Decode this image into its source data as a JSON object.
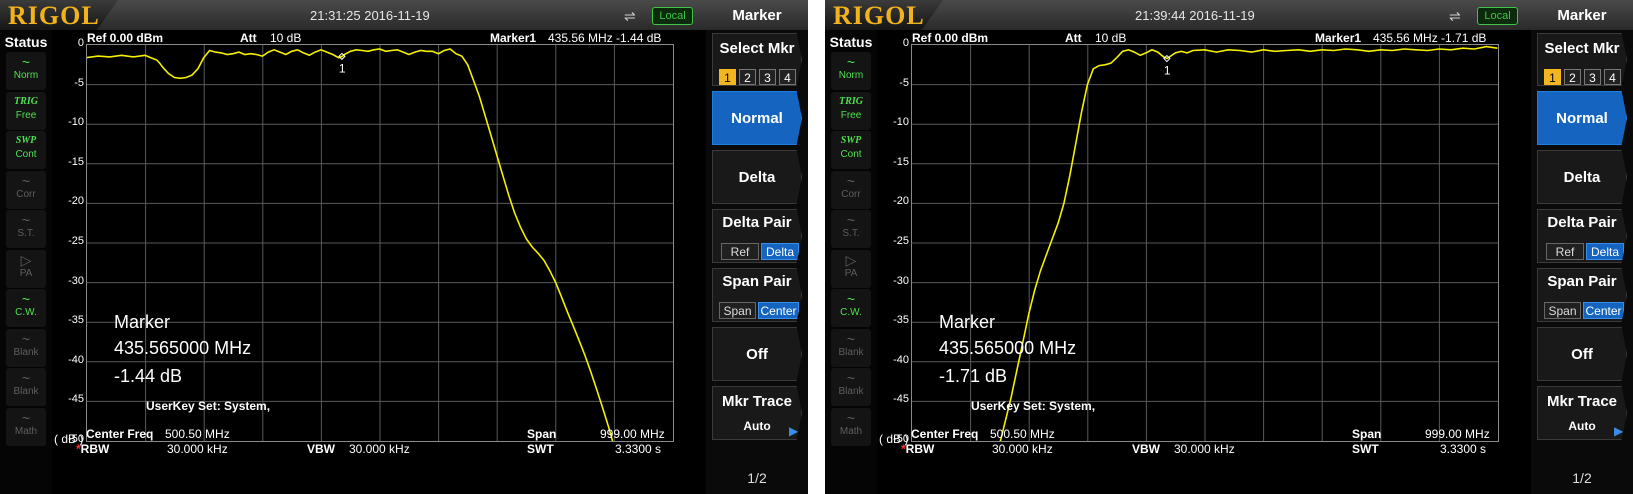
{
  "screens": [
    {
      "logo": "RIGOL",
      "datetime": "21:31:25 2016-11-19",
      "local_label": "Local",
      "status": {
        "title": "Status",
        "items": [
          {
            "icon": "~",
            "label": "Norm",
            "active": true
          },
          {
            "icon": "TRIG",
            "label": "Free",
            "active": true
          },
          {
            "icon": "SWP",
            "label": "Cont",
            "active": true
          },
          {
            "icon": "~",
            "label": "Corr",
            "active": false
          },
          {
            "icon": "~",
            "label": "S.T.",
            "active": false
          },
          {
            "icon": "▷",
            "label": "PA",
            "active": false
          },
          {
            "icon": "~",
            "label": "C.W.",
            "active": true
          },
          {
            "icon": "~",
            "label": "Blank",
            "active": false
          },
          {
            "icon": "~",
            "label": "Blank",
            "active": false
          },
          {
            "icon": "~",
            "label": "Math",
            "active": false
          }
        ]
      },
      "header": {
        "ref": "Ref  0.00 dBm",
        "att_label": "Att",
        "att_value": "10 dB",
        "marker_label": "Marker1",
        "marker_value": "435.56 MHz   -1.44 dB"
      },
      "yticks": [
        "0",
        "-5",
        "-10",
        "-15",
        "-20",
        "-25",
        "-30",
        "-35",
        "-40",
        "-45",
        "-50"
      ],
      "marker_panel": {
        "title": "Marker",
        "freq": "435.565000 MHz",
        "level": "-1.44 dB"
      },
      "marker_flag": "1",
      "userkey": "UserKey Set:   System,",
      "footer": {
        "unit": "( dB )",
        "center_label": "Center Freq",
        "center_value": "500.50 MHz",
        "span_label": "Span",
        "span_value": "999.00 MHz",
        "rbw_star": "*",
        "rbw_label": "RBW",
        "rbw_value": "30.000 kHz",
        "vbw_label": "VBW",
        "vbw_value": "30.000 kHz",
        "swt_label": "SWT",
        "swt_value": "3.3300 s"
      },
      "menu": {
        "title": "Marker",
        "select_mkr": "Select Mkr",
        "mkr_numbers": [
          "1",
          "2",
          "3",
          "4"
        ],
        "normal": "Normal",
        "delta": "Delta",
        "delta_pair": "Delta Pair",
        "delta_pair_ref": "Ref",
        "delta_pair_delta": "Delta",
        "span_pair": "Span Pair",
        "span_pair_span": "Span",
        "span_pair_center": "Center",
        "off": "Off",
        "mkr_trace": "Mkr Trace",
        "mkr_trace_value": "Auto",
        "page": "1/2"
      },
      "chart_data": {
        "type": "line",
        "series": [
          {
            "x": [
              0,
              20,
              40,
              60,
              80,
              100,
              110,
              120,
              125,
              130,
              140,
              150,
              160,
              170,
              180,
              190,
              200,
              210,
              220,
              230,
              240,
              250,
              260,
              270,
              280,
              290,
              300,
              310,
              320,
              330,
              340,
              350,
              360,
              370,
              380,
              390,
              400,
              410,
              420,
              430,
              436,
              440,
              450,
              460,
              470,
              480,
              490,
              500,
              510,
              520,
              530,
              540,
              550,
              560,
              570,
              580,
              590,
              600,
              610,
              620,
              630,
              640,
              650,
              660,
              670,
              680,
              690,
              700,
              710,
              720,
              730,
              740,
              750,
              760,
              770,
              780,
              790,
              800,
              810,
              820,
              830,
              840,
              850,
              860,
              870,
              880,
              890,
              900,
              910,
              920,
              930,
              940,
              950,
              960,
              970,
              980,
              990,
              999
            ],
            "y": [
              -1.6,
              -1.4,
              -1.5,
              -1.3,
              -1.5,
              -1.3,
              -1.6,
              -1.9,
              -2.3,
              -2.8,
              -3.6,
              -4.1,
              -4.2,
              -4.1,
              -3.8,
              -3.0,
              -1.6,
              -0.7,
              -0.9,
              -1.0,
              -1.2,
              -1.1,
              -0.9,
              -1.2,
              -1.1,
              -1.2,
              -1.4,
              -0.9,
              -0.6,
              -0.9,
              -1.2,
              -0.8,
              -0.6,
              -1.0,
              -1.3,
              -0.9,
              -0.6,
              -0.9,
              -1.2,
              -1.6,
              -1.44,
              -1.2,
              -0.8,
              -0.6,
              -0.7,
              -0.8,
              -0.6,
              -0.5,
              -0.8,
              -0.7,
              -0.6,
              -0.9,
              -1.2,
              -0.9,
              -0.7,
              -0.8,
              -0.8,
              -1.1,
              -0.7,
              -0.5,
              -1.1,
              -1.4,
              -2.5,
              -4.5,
              -6.5,
              -9,
              -11.5,
              -14,
              -16.5,
              -19,
              -21.2,
              -23,
              -24.5,
              -25.5,
              -26.3,
              -27.2,
              -28.5,
              -30,
              -31.8,
              -33.7,
              -35.5,
              -37.3,
              -39.2,
              -41.3,
              -43.5,
              -45.8,
              -48.2,
              -50.8
            ],
            "x_real": [
              0,
              20,
              40,
              60,
              80,
              100,
              110,
              120,
              125,
              130,
              140,
              150,
              160,
              170,
              180,
              190,
              200,
              210,
              220,
              230,
              240,
              250,
              260,
              270,
              280,
              290,
              300,
              310,
              320,
              330,
              340,
              350,
              360,
              370,
              380,
              390,
              400,
              410,
              420,
              430,
              436,
              440,
              450,
              460,
              470,
              480,
              490,
              500,
              510,
              520,
              530,
              540,
              550,
              560,
              570,
              580,
              590,
              600,
              610,
              620,
              630,
              640,
              650,
              660,
              670,
              680,
              690,
              700,
              710,
              720,
              730,
              740,
              750,
              760,
              770,
              780,
              790,
              800,
              810,
              820,
              830,
              840,
              850,
              860,
              870,
              880,
              890,
              900
            ]
          }
        ],
        "xlim": [
          1,
          1000
        ],
        "ylim": [
          -50,
          0
        ],
        "ylabel": "( dB )",
        "grid": true,
        "marker": {
          "x": 435.565,
          "y": -1.44
        }
      }
    },
    {
      "logo": "RIGOL",
      "datetime": "21:39:44 2016-11-19",
      "local_label": "Local",
      "status": {
        "title": "Status",
        "items": [
          {
            "icon": "~",
            "label": "Norm",
            "active": true
          },
          {
            "icon": "TRIG",
            "label": "Free",
            "active": true
          },
          {
            "icon": "SWP",
            "label": "Cont",
            "active": true
          },
          {
            "icon": "~",
            "label": "Corr",
            "active": false
          },
          {
            "icon": "~",
            "label": "S.T.",
            "active": false
          },
          {
            "icon": "▷",
            "label": "PA",
            "active": false
          },
          {
            "icon": "~",
            "label": "C.W.",
            "active": true
          },
          {
            "icon": "~",
            "label": "Blank",
            "active": false
          },
          {
            "icon": "~",
            "label": "Blank",
            "active": false
          },
          {
            "icon": "~",
            "label": "Math",
            "active": false
          }
        ]
      },
      "header": {
        "ref": "Ref  0.00 dBm",
        "att_label": "Att",
        "att_value": "10 dB",
        "marker_label": "Marker1",
        "marker_value": "435.56 MHz   -1.71 dB"
      },
      "yticks": [
        "0",
        "-5",
        "-10",
        "-15",
        "-20",
        "-25",
        "-30",
        "-35",
        "-40",
        "-45",
        "-50"
      ],
      "marker_panel": {
        "title": "Marker",
        "freq": "435.565000 MHz",
        "level": "-1.71 dB"
      },
      "marker_flag": "1",
      "userkey": "UserKey Set:   System,",
      "footer": {
        "unit": "( dB )",
        "center_label": "Center Freq",
        "center_value": "500.50 MHz",
        "span_label": "Span",
        "span_value": "999.00 MHz",
        "rbw_star": "*",
        "rbw_label": "RBW",
        "rbw_value": "30.000 kHz",
        "vbw_label": "VBW",
        "vbw_value": "30.000 kHz",
        "swt_label": "SWT",
        "swt_value": "3.3300 s"
      },
      "menu": {
        "title": "Marker",
        "select_mkr": "Select Mkr",
        "mkr_numbers": [
          "1",
          "2",
          "3",
          "4"
        ],
        "normal": "Normal",
        "delta": "Delta",
        "delta_pair": "Delta Pair",
        "delta_pair_ref": "Ref",
        "delta_pair_delta": "Delta",
        "span_pair": "Span Pair",
        "span_pair_span": "Span",
        "span_pair_center": "Center",
        "off": "Off",
        "mkr_trace": "Mkr Trace",
        "mkr_trace_value": "Auto",
        "page": "1/2"
      },
      "chart_data": {
        "type": "line",
        "series": [
          {
            "x": [
              150,
              160,
              170,
              180,
              190,
              200,
              210,
              220,
              230,
              240,
              250,
              260,
              270,
              280,
              290,
              300,
              310,
              320,
              330,
              340,
              350,
              360,
              370,
              380,
              390,
              400,
              410,
              420,
              430,
              436,
              440,
              450,
              460,
              470,
              480,
              500,
              520,
              540,
              560,
              580,
              600,
              620,
              640,
              660,
              680,
              700,
              720,
              740,
              760,
              780,
              800,
              820,
              840,
              860,
              880,
              900,
              920,
              940,
              960,
              980,
              999
            ],
            "y": [
              -50.5,
              -47.5,
              -44.5,
              -41,
              -37.5,
              -34,
              -31,
              -28.5,
              -26.5,
              -24.5,
              -22.5,
              -20,
              -16.5,
              -12.5,
              -8.5,
              -5,
              -3,
              -2.6,
              -2.5,
              -2.3,
              -1.6,
              -0.8,
              -0.6,
              -0.9,
              -1.3,
              -1.0,
              -0.6,
              -0.9,
              -1.5,
              -1.71,
              -1.5,
              -1.0,
              -0.8,
              -1.0,
              -0.7,
              -0.6,
              -0.9,
              -0.6,
              -0.7,
              -0.9,
              -0.6,
              -0.8,
              -0.7,
              -0.6,
              -0.8,
              -0.6,
              -0.7,
              -0.5,
              -0.6,
              -0.8,
              -0.6,
              -0.7,
              -0.5,
              -0.6,
              -0.7,
              -0.5,
              -0.6,
              -0.4,
              -0.5,
              -0.2,
              -0.4
            ]
          }
        ],
        "xlim": [
          1,
          1000
        ],
        "ylim": [
          -50,
          0
        ],
        "ylabel": "( dB )",
        "grid": true,
        "marker": {
          "x": 435.565,
          "y": -1.71
        }
      }
    }
  ]
}
